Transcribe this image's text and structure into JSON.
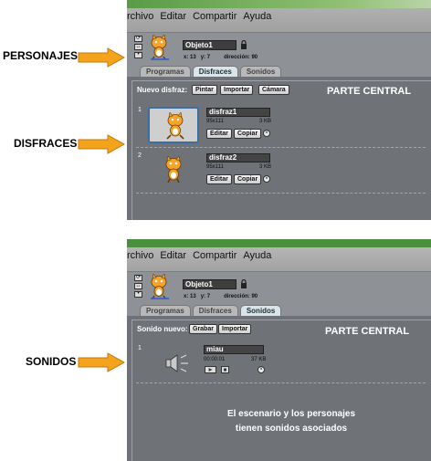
{
  "labels": {
    "personajes": "PERSONAJES",
    "disfraces": "DISFRACES",
    "sonidos": "SONIDOS"
  },
  "colors": {
    "arrow": "#f3a31c",
    "arrow_stroke": "#c4790b"
  },
  "top_panel": {
    "menu": [
      "rchivo",
      "Editar",
      "Compartir",
      "Ayuda"
    ],
    "sprite": {
      "name": "Objeto1",
      "x_label": "x:",
      "x_value": "13",
      "y_label": "y:",
      "y_value": "7",
      "direction_label": "dirección:",
      "direction_value": "90"
    },
    "tabs": [
      "Programas",
      "Disfraces",
      "Sonidos"
    ],
    "active_tab": "Disfraces",
    "toolbar": {
      "title": "Nuevo disfraz:",
      "paint": "Pintar",
      "import": "Importar",
      "camera": "Cámara"
    },
    "central_label": "PARTE CENTRAL",
    "costumes": [
      {
        "num": "1",
        "name": "disfraz1",
        "dims": "95x111",
        "size": "3 KB",
        "edit": "Editar",
        "copy": "Copiar"
      },
      {
        "num": "2",
        "name": "disfraz2",
        "dims": "95x111",
        "size": "3 KB",
        "edit": "Editar",
        "copy": "Copiar"
      }
    ]
  },
  "bottom_panel": {
    "menu": [
      "rchivo",
      "Editar",
      "Compartir",
      "Ayuda"
    ],
    "sprite": {
      "name": "Objeto1",
      "x_label": "x:",
      "x_value": "13",
      "y_label": "y:",
      "y_value": "7",
      "direction_label": "dirección:",
      "direction_value": "90"
    },
    "tabs": [
      "Programas",
      "Disfraces",
      "Sonidos"
    ],
    "active_tab": "Sonidos",
    "toolbar": {
      "title": "Sonido nuevo:",
      "record": "Grabar",
      "import": "Importar"
    },
    "central_label": "PARTE CENTRAL",
    "sounds": [
      {
        "num": "1",
        "name": "miau",
        "duration": "00:00:01",
        "size": "37 KB"
      }
    ],
    "note_line1": "El escenario y los personajes",
    "note_line2": "tienen sonidos asociados"
  }
}
